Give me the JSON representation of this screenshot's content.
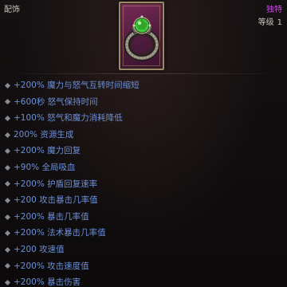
{
  "tooltip": {
    "category": "配饰",
    "rarity": "独特",
    "level_label": "等级",
    "level_value": "1",
    "item_icon": "ring-with-green-gem-icon",
    "colors": {
      "affix_text": "#6c8fd6",
      "rarity": "#c44ed8",
      "frame_bg": "#6a2450",
      "gem": "#3fcf3a"
    },
    "affixes": [
      "+200% 魔力与怒气互转时间缩短",
      "+600秒 怒气保持时间",
      "+100% 怒气和魔力消耗降低",
      "200% 资源生成",
      "+200% 魔力回复",
      "+90% 全局吸血",
      "+200% 护盾回复速率",
      "+200 攻击暴击几率值",
      "+200% 暴击几率值",
      "+200% 法术暴击几率值",
      "+200 攻速值",
      "+200% 攻击速度值",
      "+200% 暴击伤害"
    ]
  }
}
